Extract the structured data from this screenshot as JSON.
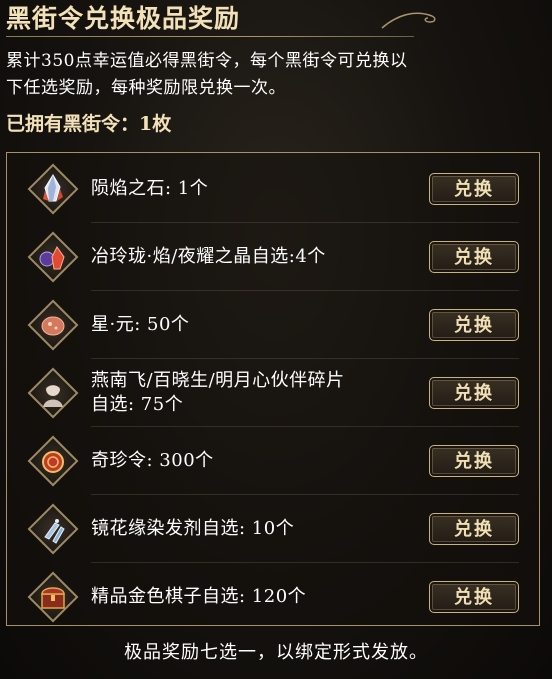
{
  "header": {
    "title": "黑街令兑换极品奖励",
    "description_line1": "累计350点幸运值必得黑街令，每个黑街令可兑换以",
    "description_line2": "下任选奖励，每种奖励限兑换一次。",
    "owned_text": "已拥有黑街令：1枚"
  },
  "rewards": [
    {
      "label": "陨焰之石: 1个",
      "label_line2": "",
      "icon": "crystal-shard-icon",
      "button": "兑换"
    },
    {
      "label": "冶玲珑·焰/夜耀之晶自选:4个",
      "label_line2": "",
      "icon": "crystal-pair-icon",
      "button": "兑换"
    },
    {
      "label": "星·元: 50个",
      "label_line2": "",
      "icon": "star-orb-icon",
      "button": "兑换"
    },
    {
      "label": "燕南飞/百晓生/明月心伙伴碎片",
      "label_line2": "自选: 75个",
      "icon": "character-portrait-icon",
      "button": "兑换"
    },
    {
      "label": "奇珍令: 300个",
      "label_line2": "",
      "icon": "token-coin-icon",
      "button": "兑换"
    },
    {
      "label": "镜花缘染发剂自选: 10个",
      "label_line2": "",
      "icon": "hair-dye-icon",
      "button": "兑换"
    },
    {
      "label": "精品金色棋子自选: 120个",
      "label_line2": "",
      "icon": "treasure-chest-icon",
      "button": "兑换"
    }
  ],
  "footer": {
    "note": "极品奖励七选一，以绑定形式发放。"
  }
}
